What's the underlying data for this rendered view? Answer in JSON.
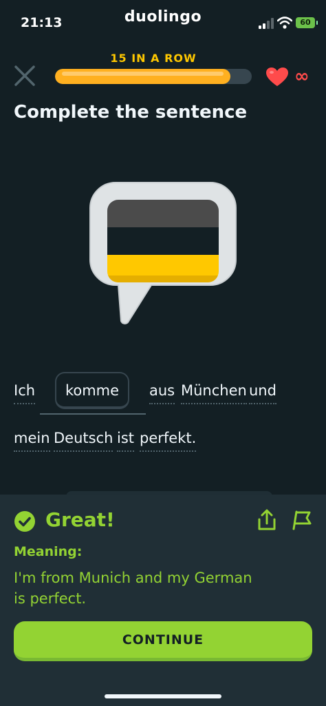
{
  "status": {
    "time": "21:13",
    "app": "duolingo",
    "battery": "60"
  },
  "header": {
    "streak_label": "15 IN A ROW",
    "progress": 0.89,
    "hearts": "∞"
  },
  "prompt": {
    "title": "Complete the sentence"
  },
  "sentence": {
    "words_line1": [
      "Ich",
      "aus",
      "München",
      "und"
    ],
    "answer": "komme",
    "words_line2": [
      "mein",
      "Deutsch",
      "ist",
      "perfekt."
    ]
  },
  "feedback": {
    "title": "Great!",
    "meaning_label": "Meaning:",
    "meaning_line1": "I'm from Munich and my German",
    "meaning_line2": "is perfect.",
    "continue_label": "CONTINUE"
  },
  "colors": {
    "accent": "#93d333",
    "streak": "#ffc800",
    "heart": "#ff4b4b",
    "background": "#131f24"
  }
}
